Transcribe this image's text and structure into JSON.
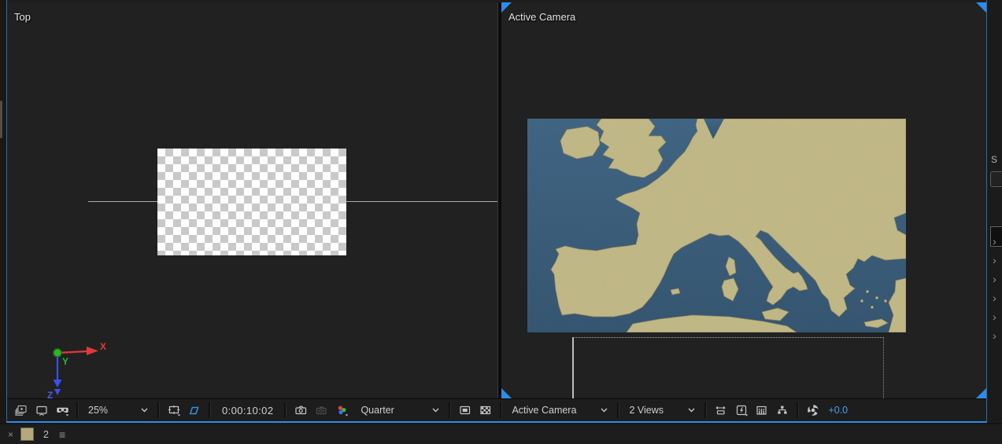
{
  "views": {
    "left": {
      "label": "Top"
    },
    "right": {
      "label": "Active Camera"
    }
  },
  "toolbar": {
    "zoom": {
      "value": "25%"
    },
    "timecode": "0:00:10:02",
    "resolution": {
      "value": "Quarter"
    },
    "camera_view": {
      "value": "Active Camera"
    },
    "view_layout": {
      "value": "2 Views"
    },
    "exposure": {
      "value": "+0.0"
    }
  },
  "gizmo": {
    "x": "X",
    "y": "Y",
    "z": "Z"
  },
  "layer_strip": {
    "close": "×",
    "number": "2",
    "menu": "≡"
  },
  "right_rail": {
    "partial_text": "S",
    "chevron": "›"
  },
  "icons": {
    "always-preview-icon": "stacked-frames-play",
    "primary-viewer-icon": "monitor",
    "vr-view-icon": "goggles",
    "grid-guides-icon": "safe-frame",
    "mask-visibility-icon": "blue-trapezoid",
    "snapshot-icon": "camera",
    "show-snapshot-icon": "camera-ghost",
    "channels-icon": "rgb-dots",
    "roi-icon": "region-box",
    "transparency-grid-icon": "checkerboard",
    "pixel-aspect-icon": "stretch-arrows",
    "fast-previews-icon": "lightning",
    "timeline-icon": "mini-chart",
    "flowchart-icon": "node-tree",
    "reset-exposure-icon": "shutter"
  },
  "colors": {
    "accent_blue": "#2d8ceb",
    "mask_icon_blue": "#3193dd",
    "exposure_text": "#46a0e8",
    "map_sea": "#33597b",
    "map_land": "#c6bd8a",
    "layer_swatch": "#b4a87c",
    "axis_x_red": "#e03a3a",
    "axis_y_green": "#2fb52f",
    "axis_z_blue": "#3c50f0",
    "checker_light": "#ffffff",
    "checker_dark": "#c9c9c9"
  }
}
